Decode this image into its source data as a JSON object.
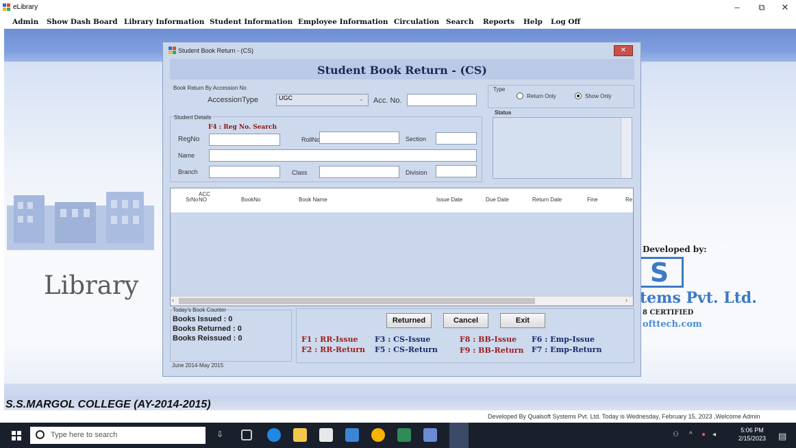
{
  "window": {
    "title": "eLibrary",
    "controls": [
      "–",
      "⧉",
      "✕"
    ]
  },
  "menu": [
    "Admin",
    "Show Dash Board",
    "Library Information",
    "Student Information",
    "Employee Information",
    "Circulation",
    "Search",
    "Reports",
    "Help",
    "Log Off"
  ],
  "background": {
    "library_word": "Library",
    "developed_by": "Developed by:",
    "logo_letter": "S",
    "company_tail": "tems Pvt. Ltd.",
    "certified": "8 CERTIFIED",
    "website": "ofttech.com",
    "college": "S.S.MARGOL COLLEGE (AY-2014-2015)",
    "status_line": "Developed By Qualsoft Systems Pvt. Ltd.   Today is Wednesday, February 15, 2023   ,Welcome Admin"
  },
  "dialog": {
    "title": "Student Book Return - (CS)",
    "heading": "Student Book Return - (CS)",
    "accession_group": "Book Return By Accession No",
    "accession_type_label": "AccessionType",
    "accession_type_value": "UGC",
    "acc_no_label": "Acc. No.",
    "type_label": "Type",
    "type_options": [
      {
        "label": "Return Only",
        "selected": false
      },
      {
        "label": "Show Only",
        "selected": true
      }
    ],
    "status_label": "Status",
    "student_group": "Student Details",
    "reg_search_hint": "F4 : Reg No. Search",
    "fields": {
      "regno": "RegNo",
      "rollno": "RollNo",
      "section": "Section",
      "name": "Name",
      "branch": "Branch",
      "class": "Class",
      "division": "Division"
    },
    "grid_columns": [
      "SrNo",
      "ACC NO",
      "BookNo",
      "Book Name",
      "Issue Date",
      "Due Date",
      "Return Date",
      "Fine",
      "Re"
    ],
    "counter_group": "Today's Book Counter",
    "counters": [
      "Books Issued : 0",
      "Books Returned : 0",
      "Books Reissued : 0"
    ],
    "buttons": {
      "returned": "Returned",
      "cancel": "Cancel",
      "exit": "Exit"
    },
    "fkeys": {
      "f1": "F1 : RR-Issue",
      "f2": "F2 : RR-Return",
      "f3": "F3 : CS-Issue",
      "f5": "F5 : CS-Return",
      "f8": "F8 : BB-Issue",
      "f9": "F9 : BB-Return",
      "f6": "F6 : Emp-Issue",
      "f7": "F7 : Emp-Return"
    },
    "session": "June 2014-May 2015"
  },
  "taskbar": {
    "search_placeholder": "Type here to search",
    "time": "5:06 PM",
    "date": "2/15/2023"
  }
}
